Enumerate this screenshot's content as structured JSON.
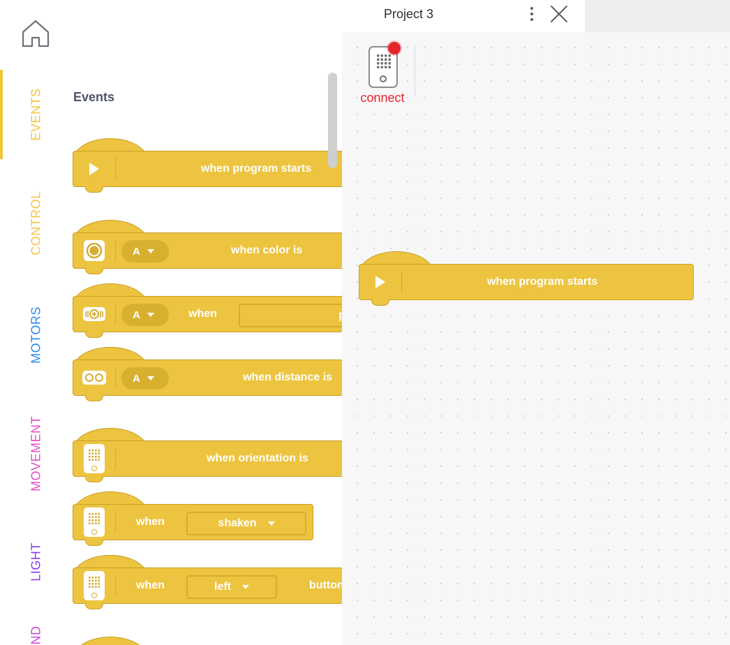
{
  "rail": {
    "categories": [
      {
        "label": "EVENTS",
        "color": "#f0c53c",
        "active": true
      },
      {
        "label": "CONTROL",
        "color": "#f3c54a"
      },
      {
        "label": "MOTORS",
        "color": "#2f8ae8"
      },
      {
        "label": "MOVEMENT",
        "color": "#e24fc8"
      },
      {
        "label": "LIGHT",
        "color": "#8a3fe6"
      },
      {
        "label": "ND",
        "color": "#c746d6"
      }
    ]
  },
  "palette": {
    "title": "Events",
    "blocks": [
      {
        "icon": "play-icon",
        "text": "when program starts"
      },
      {
        "icon": "color-sensor-icon",
        "port": "A",
        "text": "when color is"
      },
      {
        "icon": "force-sensor-icon",
        "port": "A",
        "text": "when",
        "text2": "press"
      },
      {
        "icon": "distance-sensor-icon",
        "port": "A",
        "text": "when distance is"
      },
      {
        "icon": "hub-icon",
        "text": "when orientation is"
      },
      {
        "icon": "hub-icon",
        "text": "when",
        "dropdown": "shaken"
      },
      {
        "icon": "hub-icon",
        "text": "when",
        "dropdown": "left",
        "text2": "button"
      }
    ]
  },
  "topbar": {
    "project_title": "Project 3"
  },
  "connect": {
    "label": "connect",
    "status_color": "#e5262d"
  },
  "workspace": {
    "blocks": [
      {
        "icon": "play-icon",
        "text": "when program starts"
      }
    ]
  },
  "theme": {
    "event_block": "#edc43f",
    "event_block_border": "#c99f25"
  }
}
